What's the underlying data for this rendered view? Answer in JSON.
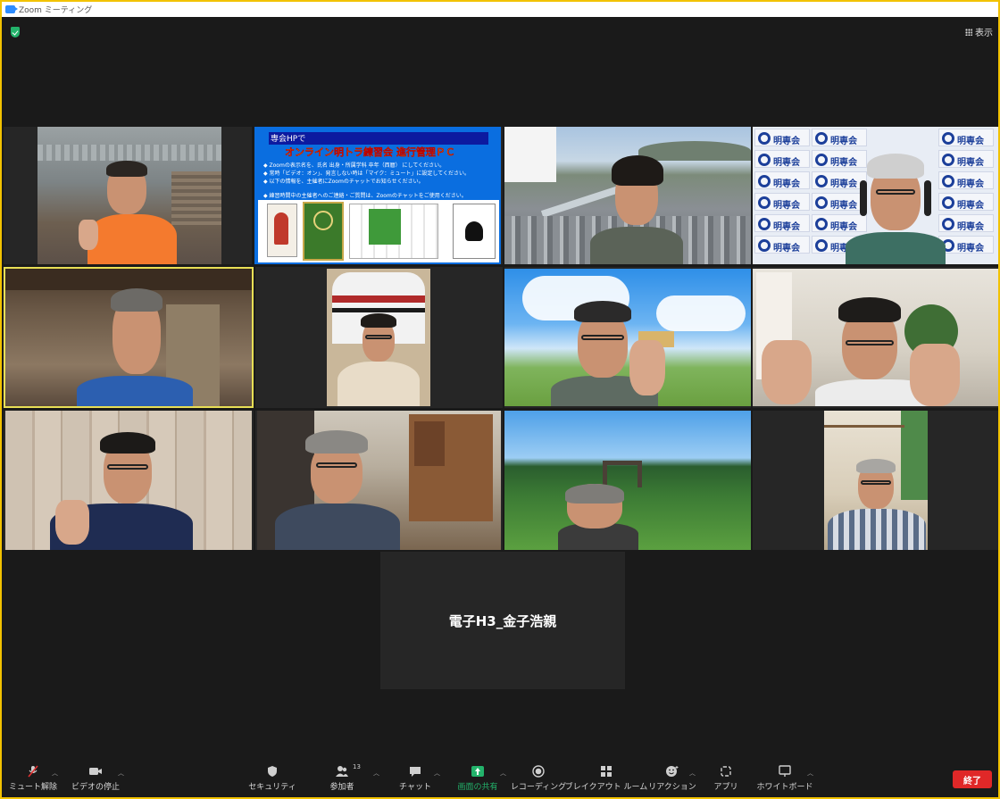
{
  "window": {
    "title": "Zoom ミーティング"
  },
  "header": {
    "view_label": "表示"
  },
  "shared_content": {
    "header_text": "専会HPで",
    "title": "オンライン明トラ練習会 進行管理ＰＣ",
    "lines": [
      "◆ Zoomの表示名を、氏名 出身・所属学科 卒年（西暦） にしてください。",
      "◆ 常時「ビデオ：オン」、発言しない時は「マイク：ミュート」に設定してください。",
      "◆ 以下の情報を、主催者にZoomのチャットでお知らせください。",
      "◆ 練習時間中の主催者へのご連絡・ご質問は、Zoomのチャットをご使用ください。"
    ]
  },
  "logo_wall": {
    "text": "明専会"
  },
  "name_only_tile": {
    "name": "電子H3_金子浩親"
  },
  "toolbar": {
    "unmute": "ミュート解除",
    "stop_video": "ビデオの停止",
    "security": "セキュリティ",
    "participants": "参加者",
    "participants_count": "13",
    "chat": "チャット",
    "share_screen": "画面の共有",
    "record": "レコーディング",
    "breakout": "ブレイクアウト ルーム",
    "reactions": "リアクション",
    "apps": "アプリ",
    "whiteboard": "ホワイトボード",
    "end": "終了"
  },
  "colors": {
    "accent_green": "#23b36b",
    "end_red": "#e02828",
    "active_speaker": "#e8df55",
    "window_frame": "#f2c200"
  }
}
